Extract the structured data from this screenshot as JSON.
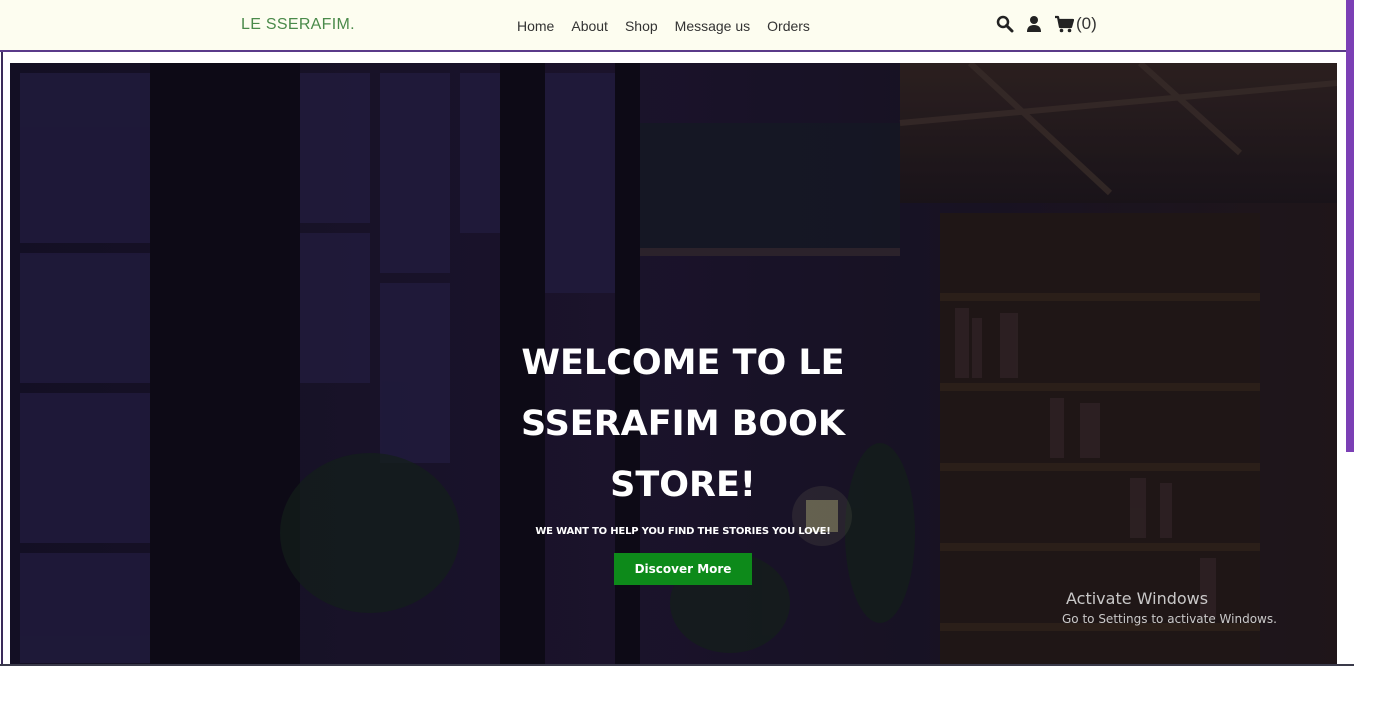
{
  "navbar": {
    "brand": "LE SSERAFIM.",
    "links": [
      {
        "label": "Home"
      },
      {
        "label": "About"
      },
      {
        "label": "Shop"
      },
      {
        "label": "Message us"
      },
      {
        "label": "Orders"
      }
    ],
    "icons": {
      "search": "search-icon",
      "user": "user-icon",
      "cart": "cart-icon"
    },
    "cart_count": "(0)"
  },
  "hero": {
    "title": "WELCOME TO LE SSERAFIM BOOK STORE!",
    "subtitle": "WE WANT TO HELP YOU FIND THE STORIES YOU LOVE!",
    "button_label": "Discover More"
  },
  "watermark": {
    "title": "Activate Windows",
    "subtitle": "Go to Settings to activate Windows."
  },
  "colors": {
    "brand": "#4a8a4a",
    "navbar_bg": "#fdfdf0",
    "accent_purple": "#7b3fb5",
    "button_green": "#0d8a1a"
  }
}
